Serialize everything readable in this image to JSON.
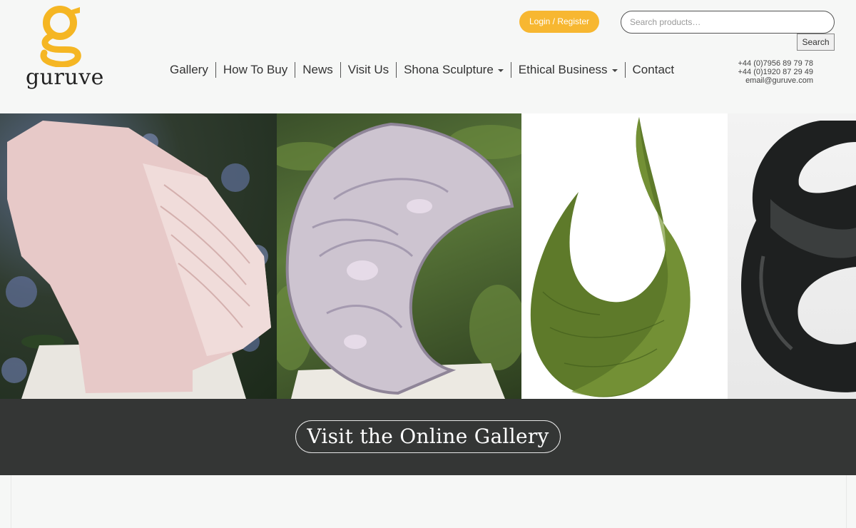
{
  "logo": {
    "letter": "g",
    "word": "guruve"
  },
  "header": {
    "login_label": "Login / Register",
    "search_placeholder": "Search products…",
    "search_button": "Search"
  },
  "nav": {
    "items": [
      {
        "label": "Gallery",
        "dropdown": false
      },
      {
        "label": "How To Buy",
        "dropdown": false
      },
      {
        "label": "News",
        "dropdown": false
      },
      {
        "label": "Visit Us",
        "dropdown": false
      },
      {
        "label": "Shona Sculpture",
        "dropdown": true
      },
      {
        "label": "Ethical Business",
        "dropdown": true
      },
      {
        "label": "Contact",
        "dropdown": false
      }
    ]
  },
  "contact": {
    "phone1": "+44 (0)7956 89 79 78",
    "phone2": "+44 (0)1920 87 29 49",
    "email": "email@guruve.com"
  },
  "gallery_cta": {
    "label": "Visit the Online Gallery"
  },
  "colors": {
    "accent": "#f7b731",
    "dark_bar": "#343635",
    "bg": "#f6f7f6"
  }
}
